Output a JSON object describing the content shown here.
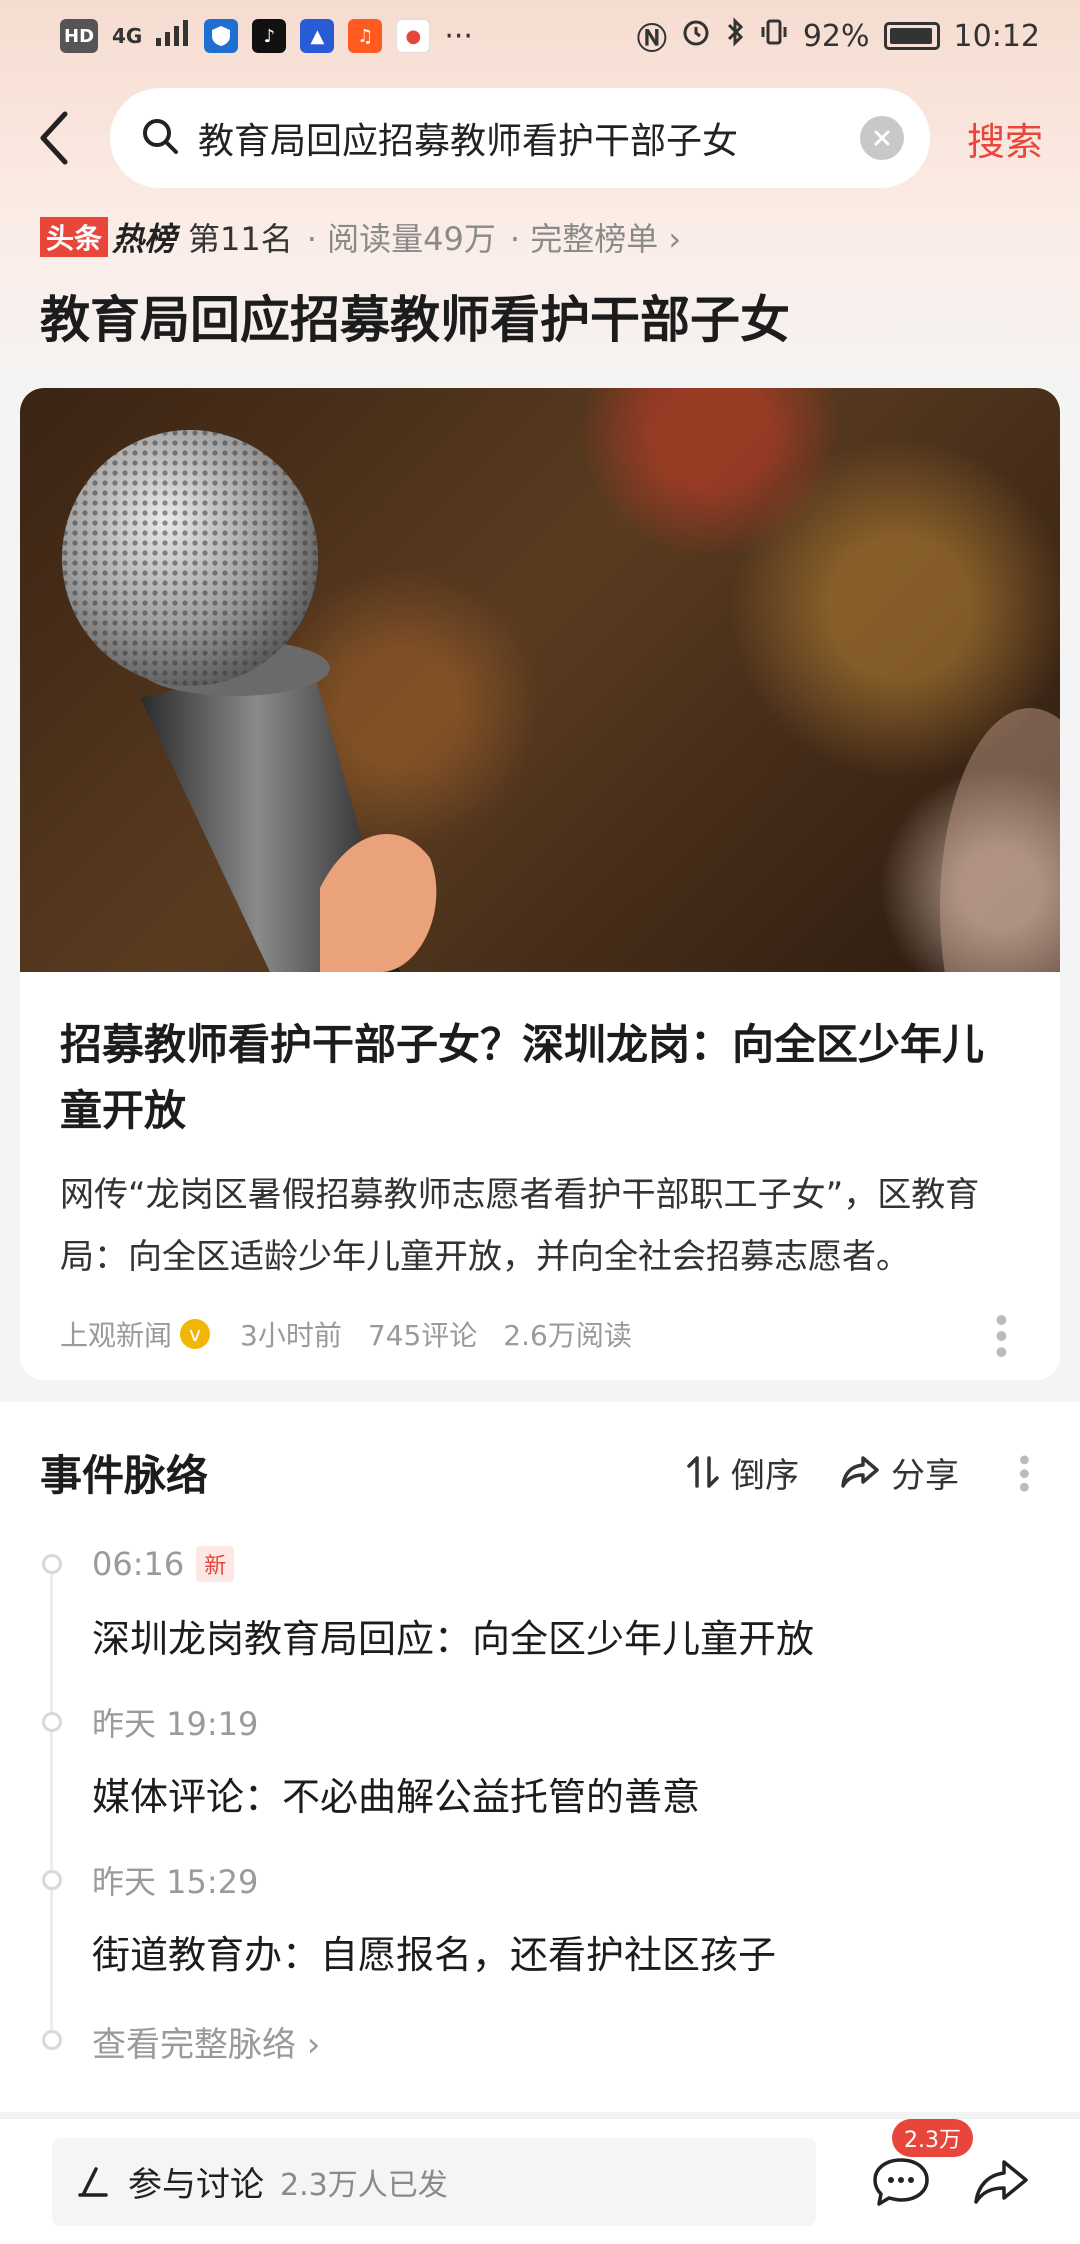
{
  "status_bar": {
    "hd": "HD",
    "network": "4G",
    "battery": "92%",
    "time": "10:12",
    "more": "···"
  },
  "search": {
    "query": "教育局回应招募教师看护干部子女",
    "search_label": "搜索"
  },
  "hot_rank": {
    "logo_a": "头条",
    "logo_b": "热榜",
    "rank": "第11名",
    "reads": "· 阅读量49万",
    "full_list": "· 完整榜单 ›"
  },
  "page_title": "教育局回应招募教师看护干部子女",
  "news_card": {
    "title": "招募教师看护干部子女？深圳龙岗：向全区少年儿童开放",
    "summary": "网传“龙岗区暑假招募教师志愿者看护干部职工子女”，区教育局：向全区适龄少年儿童开放，并向全社会招募志愿者。",
    "source": "上观新闻",
    "time_ago": "3小时前",
    "comments": "745评论",
    "reads": "2.6万阅读"
  },
  "timeline": {
    "title": "事件脉络",
    "sort_label": "倒序",
    "share_label": "分享",
    "items": [
      {
        "time": "06:16",
        "badge": "新",
        "text": "深圳龙岗教育局回应：向全区少年儿童开放"
      },
      {
        "time": "昨天 19:19",
        "text": "媒体评论：不必曲解公益托管的善意"
      },
      {
        "time": "昨天 15:29",
        "text": "街道教育办：自愿报名，还看护社区孩子"
      }
    ],
    "view_full": "查看完整脉络 ›"
  },
  "bottom_bar": {
    "discuss_label": "参与讨论",
    "discuss_count": "2.3万人已发",
    "comment_badge": "2.3万"
  },
  "colors": {
    "accent": "#e8463b",
    "verified": "#f2b705"
  }
}
